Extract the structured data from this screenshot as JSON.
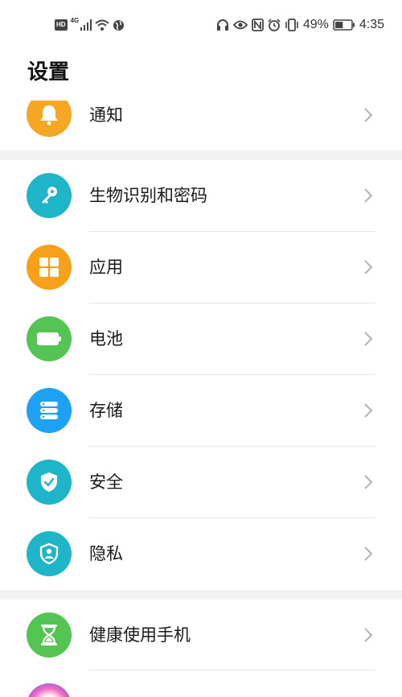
{
  "status_bar": {
    "left_badge": "HD",
    "network": "4G",
    "battery_percent": "49%",
    "time": "4:35",
    "left_icons": [
      "signal-icon",
      "wifi-icon",
      "globe-icon"
    ],
    "right_icons": [
      "headphones-icon",
      "eye-icon",
      "nfc-icon",
      "alarm-icon",
      "vibrate-icon",
      "battery-icon"
    ],
    "battery_level": 0.49
  },
  "header": {
    "title": "设置"
  },
  "settings": {
    "items": [
      {
        "label": "通知",
        "icon": "bell-icon",
        "color": "#F5A623"
      },
      {
        "label": "生物识别和密码",
        "icon": "key-icon",
        "color": "#1FB5C9"
      },
      {
        "label": "应用",
        "icon": "apps-grid-icon",
        "color": "#F7A11A"
      },
      {
        "label": "电池",
        "icon": "battery-icon",
        "color": "#54C553"
      },
      {
        "label": "存储",
        "icon": "storage-icon",
        "color": "#1DA1F2"
      },
      {
        "label": "安全",
        "icon": "shield-check-icon",
        "color": "#1FB5C9"
      },
      {
        "label": "隐私",
        "icon": "privacy-shield-icon",
        "color": "#1FB5C9"
      },
      {
        "label": "健康使用手机",
        "icon": "hourglass-icon",
        "color": "#54C553"
      },
      {
        "label": "",
        "icon": "assistant-icon",
        "color": "#E84C9C"
      }
    ]
  },
  "colors": {
    "divider": "#e5e5e5",
    "group_gap": "#f2f2f2",
    "chevron": "#b3b3b3"
  }
}
